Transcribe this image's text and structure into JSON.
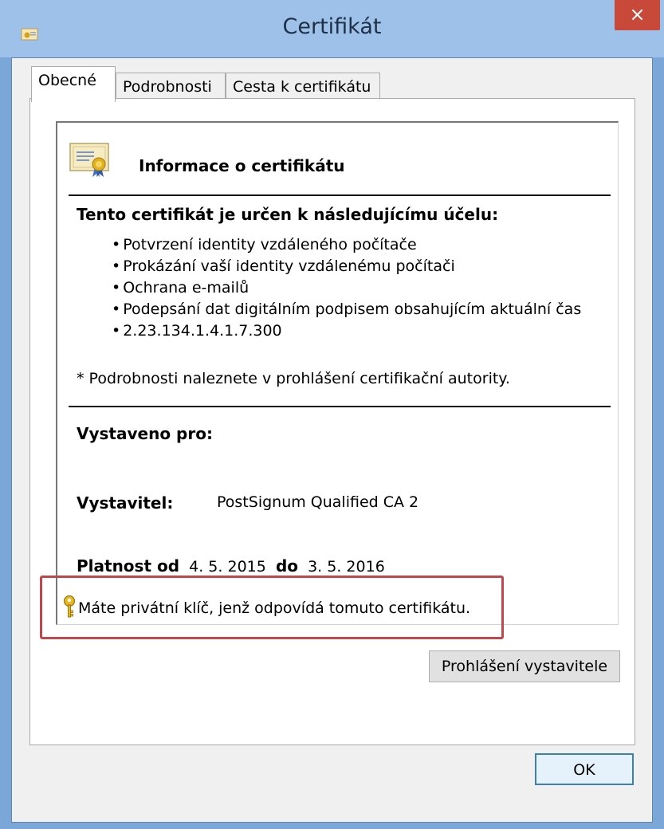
{
  "window": {
    "title": "Certifikát",
    "close_symbol": "×",
    "icon": "certificate-small-icon"
  },
  "tabs": [
    {
      "label": "Obecné",
      "active": true
    },
    {
      "label": "Podrobnosti",
      "active": false
    },
    {
      "label": "Cesta k certifikátu",
      "active": false
    }
  ],
  "info": {
    "title": "Informace o certifikátu",
    "purpose_heading": "Tento certifikát je určen k následujícímu účelu:",
    "purposes": [
      "Potvrzení identity vzdáleného počítače",
      "Prokázání vaší identity vzdálenému počítači",
      "Ochrana e-mailů",
      "Podepsání dat digitálním podpisem obsahujícím aktuální čas",
      "2.23.134.1.4.1.7.300"
    ],
    "note": "* Podrobnosti naleznete v prohlášení certifikační autority.",
    "issued_to_label": "Vystaveno pro:",
    "issuer_label": "Vystavitel:",
    "issuer_value": "PostSignum Qualified CA 2",
    "valid_from_label": "Platnost od",
    "valid_from": "4. 5. 2015",
    "valid_to_label": "do",
    "valid_to": "3. 5. 2016",
    "private_key_note": "Máte privátní klíč, jenž odpovídá tomuto certifikátu."
  },
  "buttons": {
    "issuer_statement": "Prohlášení vystavitele",
    "ok": "OK"
  },
  "colors": {
    "highlight_border": "#c0474b",
    "titlebar": "#9dc1e8",
    "close_button": "#c8493a"
  }
}
